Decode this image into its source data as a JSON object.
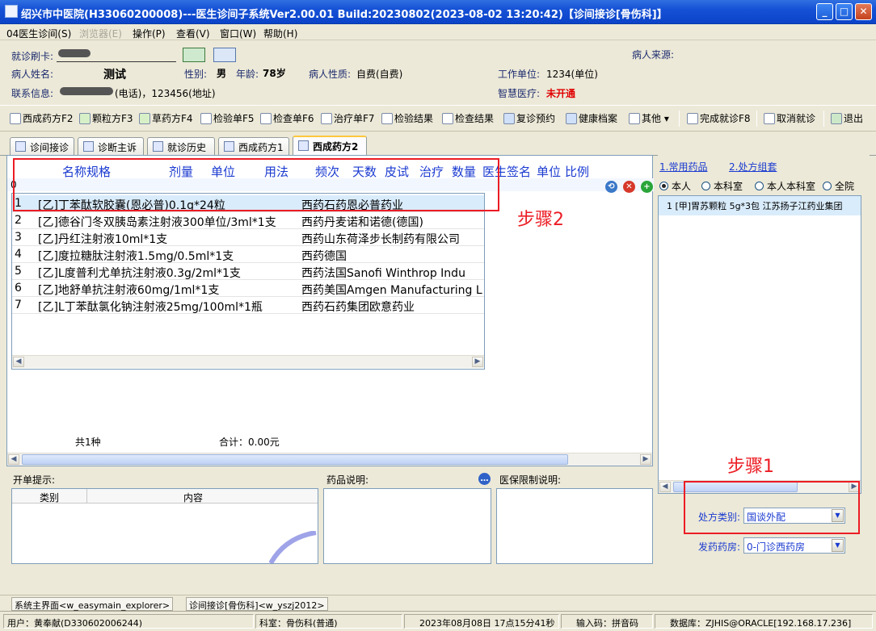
{
  "window": {
    "title": "绍兴市中医院(H33060200008)---医生诊间子系统Ver2.00.01 Build:20230802(2023-08-02 13:20:42)【诊间接诊[骨伤科]】"
  },
  "menu": [
    "04医生诊间(S)",
    "浏览器(E)",
    "操作(P)",
    "查看(V)",
    "窗口(W)",
    "帮助(H)"
  ],
  "patient": {
    "card_label": "就诊刷卡:",
    "source_label": "病人来源:",
    "name_label": "病人姓名:",
    "name": "测试",
    "gender_label": "性别:",
    "gender": "男",
    "age_label": "年龄:",
    "age": "78岁",
    "nature_label": "病人性质:",
    "nature": "自费(自费)",
    "work_label": "工作单位:",
    "work": "1234(单位)",
    "contact_label": "联系信息:",
    "contact": "(电话)，123456(地址)",
    "smart_label": "智慧医疗:",
    "smart": "未开通"
  },
  "toolbar": [
    "西成药方F2",
    "颗粒方F3",
    "草药方F4",
    "检验单F5",
    "检查单F6",
    "治疗单F7",
    "检验结果",
    "检查结果",
    "复诊预约",
    "健康档案",
    "其他",
    "完成就诊F8",
    "取消就诊",
    "退出"
  ],
  "tabs": [
    "诊间接诊",
    "诊断主诉",
    "就诊历史",
    "西成药方1",
    "西成药方2"
  ],
  "grid_headers": [
    "名称规格",
    "剂量",
    "单位",
    "用法",
    "频次",
    "天数",
    "皮试",
    "治疗",
    "数量",
    "医生签名",
    "单位",
    "比例"
  ],
  "filter_value": "0",
  "drug_list": [
    {
      "no": "1",
      "name": "[乙]丁苯酞软胶囊(恩必普)0.1g*24粒",
      "maker": "西药石药恩必普药业"
    },
    {
      "no": "2",
      "name": "[乙]德谷门冬双胰岛素注射液300单位/3ml*1支",
      "maker": "西药丹麦诺和诺德(德国)"
    },
    {
      "no": "3",
      "name": "[乙]丹红注射液10ml*1支",
      "maker": "西药山东荷泽步长制药有限公司"
    },
    {
      "no": "4",
      "name": "[乙]度拉糖肽注射液1.5mg/0.5ml*1支",
      "maker": "西药德国"
    },
    {
      "no": "5",
      "name": "[乙]L度普利尤单抗注射液0.3g/2ml*1支",
      "maker": "西药法国Sanofi Winthrop Indu"
    },
    {
      "no": "6",
      "name": "[乙]地舒单抗注射液60mg/1ml*1支",
      "maker": "西药美国Amgen Manufacturing L"
    },
    {
      "no": "7",
      "name": "[乙]L丁苯酞氯化钠注射液25mg/100ml*1瓶",
      "maker": "西药石药集团欧意药业"
    }
  ],
  "summary": {
    "count": "共1种",
    "total": "合计：0.00元"
  },
  "bottom": {
    "hint_title": "开单提示:",
    "col_type": "类别",
    "col_content": "内容",
    "drug_desc_title": "药品说明:",
    "insurance_title": "医保限制说明:"
  },
  "right": {
    "link1": "1.常用药品",
    "link2": "2.处方组套",
    "radios": [
      "本人",
      "本科室",
      "本人本科室",
      "全院"
    ],
    "selected_radio": "本人",
    "item": "1  [甲]胃苏颗粒 5g*3包 江苏扬子江药业集团",
    "rx_type_label": "处方类别:",
    "rx_type": "国谈外配",
    "pharmacy_label": "发药药房:",
    "pharmacy": "0-门诊西药房"
  },
  "annotations": {
    "step1": "步骤1",
    "step2": "步骤2"
  },
  "taskbar": [
    "系统主界面<w_easymain_explorer>",
    "诊间接诊[骨伤科]<w_yszj2012>"
  ],
  "status": {
    "user": "用户：黄奉献(D330602006244)",
    "dept": "科室：骨伤科(普通)",
    "time": "2023年08月08日 17点15分41秒",
    "input": "输入码：拼音码",
    "db": "数据库：ZJHIS@ORACLE[192.168.17.236]"
  },
  "colors": {
    "accent": "#1a3ad0",
    "annotation": "#ec1c24",
    "title_bar": "#0b43c8"
  }
}
